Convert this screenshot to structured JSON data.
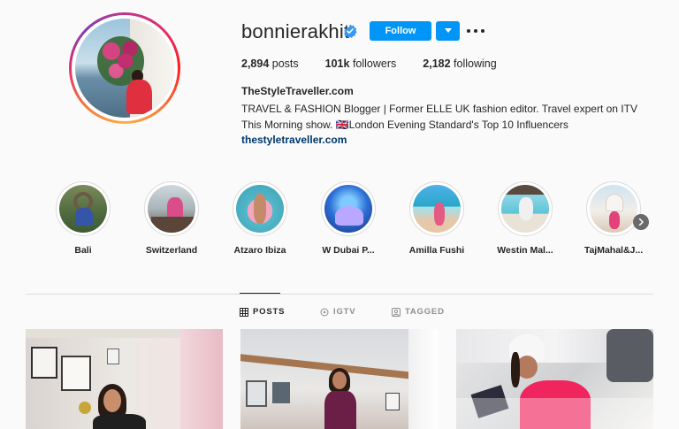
{
  "profile": {
    "username": "bonnierakhit",
    "verified": true,
    "follow_label": "Follow",
    "stats": {
      "posts_count": "2,894",
      "posts_label": "posts",
      "followers_count": "101k",
      "followers_label": "followers",
      "following_count": "2,182",
      "following_label": "following"
    },
    "bio_name": "TheStyleTraveller.com",
    "bio_text": "TRAVEL & FASHION Blogger | Former ELLE UK fashion editor. Travel expert on ITV This Morning show. 🇬🇧London Evening Standard's Top 10 Influencers",
    "bio_link": "thestyletraveller.com"
  },
  "highlights": [
    {
      "label": "Bali"
    },
    {
      "label": "Switzerland"
    },
    {
      "label": "Atzaro Ibiza"
    },
    {
      "label": "W Dubai P..."
    },
    {
      "label": "Amilla Fushi"
    },
    {
      "label": "Westin Mal..."
    },
    {
      "label": "TajMahal&J..."
    }
  ],
  "tabs": [
    {
      "label": "POSTS",
      "active": true
    },
    {
      "label": "IGTV",
      "active": false
    },
    {
      "label": "TAGGED",
      "active": false
    }
  ],
  "colors": {
    "accent": "#0095f6",
    "link": "#00376b",
    "text": "#262626",
    "muted": "#8e8e8e",
    "background": "#fafafa"
  }
}
